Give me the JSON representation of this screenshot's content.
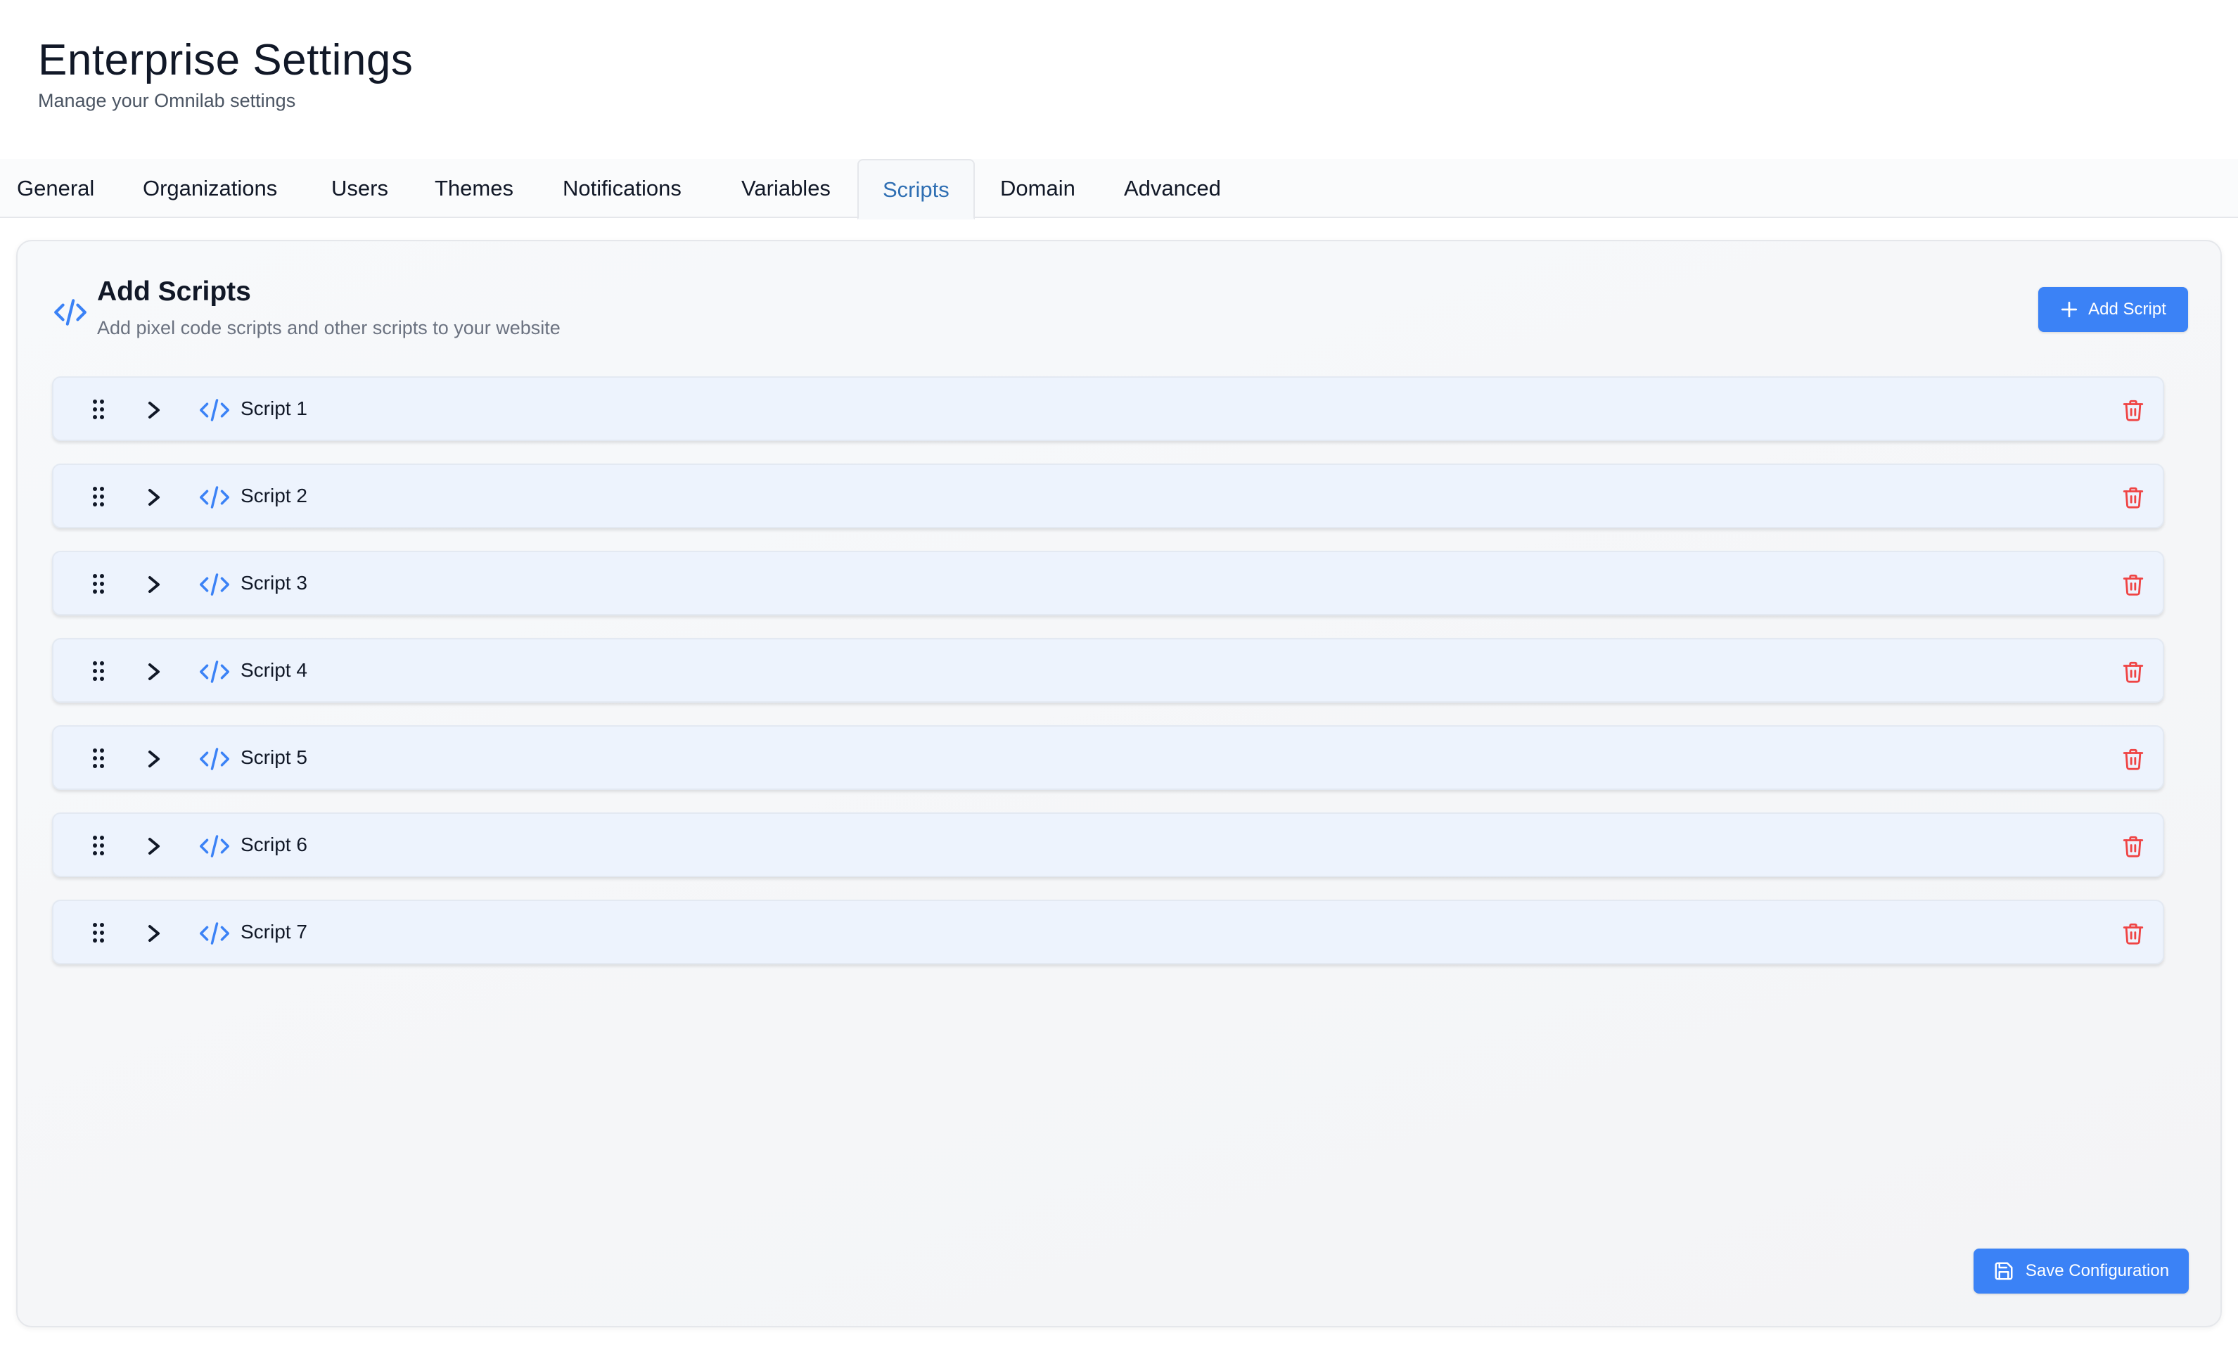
{
  "header": {
    "title": "Enterprise Settings",
    "subtitle": "Manage your Omnilab settings"
  },
  "tabs": [
    {
      "label": "General",
      "active": false
    },
    {
      "label": "Organizations",
      "active": false
    },
    {
      "label": "Users",
      "active": false
    },
    {
      "label": "Themes",
      "active": false
    },
    {
      "label": "Notifications",
      "active": false
    },
    {
      "label": "Variables",
      "active": false
    },
    {
      "label": "Scripts",
      "active": true
    },
    {
      "label": "Domain",
      "active": false
    },
    {
      "label": "Advanced",
      "active": false
    }
  ],
  "section": {
    "icon": "code-icon",
    "title": "Add Scripts",
    "description": "Add pixel code scripts and other scripts to your website",
    "add_button_label": "Add Script"
  },
  "scripts": [
    {
      "name": "Script 1"
    },
    {
      "name": "Script 2"
    },
    {
      "name": "Script 3"
    },
    {
      "name": "Script 4"
    },
    {
      "name": "Script 5"
    },
    {
      "name": "Script 6"
    },
    {
      "name": "Script 7"
    }
  ],
  "footer": {
    "save_button_label": "Save Configuration"
  },
  "colors": {
    "accent": "#3b82f6",
    "active_tab": "#2f6fb3",
    "danger": "#ef4444",
    "row_background": "#edf3fd"
  }
}
